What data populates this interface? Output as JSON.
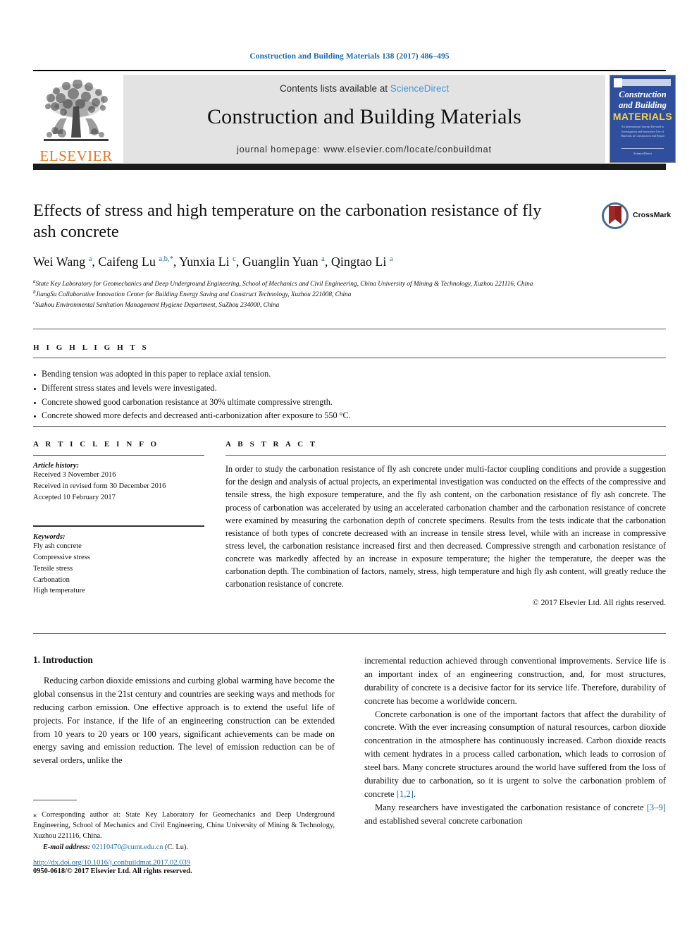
{
  "running_head": "Construction and Building Materials 138 (2017) 486–495",
  "masthead": {
    "contents_prefix": "Contents lists available at ",
    "sciencedirect": "ScienceDirect",
    "journal_title": "Construction and Building Materials",
    "homepage": "journal homepage: www.elsevier.com/locate/conbuildmat",
    "publisher": "ELSEVIER",
    "cover": {
      "line1": "Construction",
      "line2": "and Building",
      "line3": "MATERIALS",
      "blurb": "An International Journal Devoted to Investigation and Innovative Use of Materials in Construction and Repair",
      "footer": "ScienceDirect"
    }
  },
  "article": {
    "title": "Effects of stress and high temperature on the carbonation resistance of fly ash concrete",
    "crossmark_label": "CrossMark",
    "authors_html": "Wei Wang <sup>a</sup>, Caifeng Lu <sup>a,b,</sup><sup>*</sup>, Yunxia Li <sup>c</sup>, Guanglin Yuan <sup>a</sup>, Qingtao Li <sup>a</sup>",
    "affiliations": [
      {
        "marker": "a",
        "text": "State Key Laboratory for Geomechanics and Deep Underground Engineering, School of Mechanics and Civil Engineering, China University of Mining & Technology, Xuzhou 221116, China"
      },
      {
        "marker": "b",
        "text": "JiangSu Collaborative Innovation Center for Building Energy Saving and Construct Technology, Xuzhou 221008, China"
      },
      {
        "marker": "c",
        "text": "Suzhou Environmental Sanitation Management Hygiene Department, SuZhou 234000, China"
      }
    ]
  },
  "highlights": {
    "heading": "H I G H L I G H T S",
    "items": [
      "Bending tension was adopted in this paper to replace axial tension.",
      "Different stress states and levels were investigated.",
      "Concrete showed good carbonation resistance at 30% ultimate compressive strength.",
      "Concrete showed more defects and decreased anti-carbonization after exposure to 550 °C."
    ]
  },
  "article_info": {
    "heading": "A R T I C L E   I N F O",
    "history_label": "Article history:",
    "history": [
      "Received 3 November 2016",
      "Received in revised form 30 December 2016",
      "Accepted 10 February 2017"
    ],
    "keywords_label": "Keywords:",
    "keywords": [
      "Fly ash concrete",
      "Compressive stress",
      "Tensile stress",
      "Carbonation",
      "High temperature"
    ]
  },
  "abstract": {
    "heading": "A B S T R A C T",
    "body": "In order to study the carbonation resistance of fly ash concrete under multi-factor coupling conditions and provide a suggestion for the design and analysis of actual projects, an experimental investigation was conducted on the effects of the compressive and tensile stress, the high exposure temperature, and the fly ash content, on the carbonation resistance of fly ash concrete. The process of carbonation was accelerated by using an accelerated carbonation chamber and the carbonation resistance of concrete were examined by measuring the carbonation depth of concrete specimens. Results from the tests indicate that the carbonation resistance of both types of concrete decreased with an increase in tensile stress level, while with an increase in compressive stress level, the carbonation resistance increased first and then decreased. Compressive strength and carbonation resistance of concrete was markedly affected by an increase in exposure temperature; the higher the temperature, the deeper was the carbonation depth. The combination of factors, namely, stress, high temperature and high fly ash content, will greatly reduce the carbonation resistance of concrete.",
    "copyright": "© 2017 Elsevier Ltd. All rights reserved."
  },
  "body": {
    "section_heading": "1. Introduction",
    "left_para_1": "Reducing carbon dioxide emissions and curbing global warming have become the global consensus in the 21st century and countries are seeking ways and methods for reducing carbon emission. One effective approach is to extend the useful life of projects. For instance, if the life of an engineering construction can be extended from 10 years to 20 years or 100 years, significant achievements can be made on energy saving and emission reduction. The level of emission reduction can be of several orders, unlike the",
    "right_para_1": "incremental reduction achieved through conventional improvements. Service life is an important index of an engineering construction, and, for most structures, durability of concrete is a decisive factor for its service life. Therefore, durability of concrete has become a worldwide concern.",
    "right_para_2a": "Concrete carbonation is one of the important factors that affect the durability of concrete. With the ever increasing consumption of natural resources, carbon dioxide concentration in the atmosphere has continuously increased. Carbon dioxide reacts with cement hydrates in a process called carbonation, which leads to corrosion of steel bars. Many concrete structures around the world have suffered from the loss of durability due to carbonation, so it is urgent to solve the carbonation problem of concrete ",
    "right_para_2_cite": "[1,2]",
    "right_para_2b": ".",
    "right_para_3a": "Many researchers have investigated the carbonation resistance of concrete ",
    "right_para_3_cite": "[3–9]",
    "right_para_3b": " and established several concrete carbonation"
  },
  "footnote": {
    "corresponding": "⁎ Corresponding author at: State Key Laboratory for Geomechanics and Deep Underground Engineering, School of Mechanics and Civil Engineering, China University of Mining & Technology, Xuzhou 221116, China.",
    "email_label": "E-mail address:",
    "email": "02110470@cumt.edu.cn",
    "email_suffix": "(C. Lu).",
    "doi": "http://dx.doi.org/10.1016/j.conbuildmat.2017.02.039",
    "issn": "0950-0618/© 2017 Elsevier Ltd. All rights reserved."
  },
  "colors": {
    "link_blue": "#1b6ca8",
    "sciencedirect_blue": "#4a9ad4",
    "elsevier_orange": "#e87722",
    "band_grey": "#e3e3e3",
    "cover_blue": "#2f4f9e"
  }
}
